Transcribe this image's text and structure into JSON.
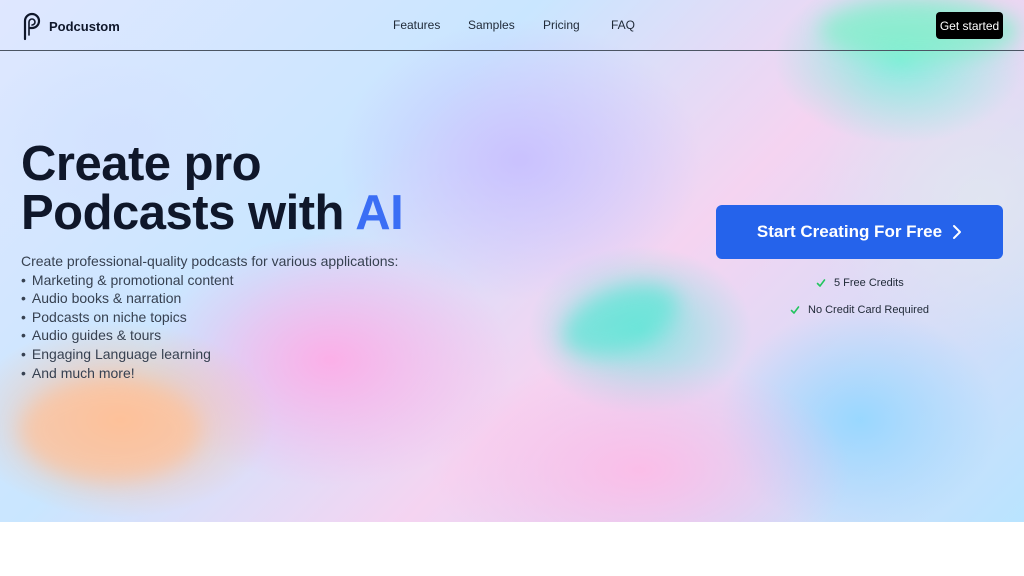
{
  "nav": {
    "brand": "Podcustom",
    "links": [
      "Features",
      "Samples",
      "Pricing",
      "FAQ"
    ],
    "cta": "Get started"
  },
  "hero": {
    "headline_line1": "Create pro",
    "headline_line2_prefix": "Podcasts with ",
    "headline_accent": "AI",
    "intro": "Create professional-quality podcasts for various applications:",
    "bullets": [
      "Marketing & promotional content",
      "Audio books & narration",
      "Podcasts on niche topics",
      "Audio guides & tours",
      "Engaging Language learning",
      "And much more!"
    ],
    "cta": "Start Creating For Free",
    "perks": [
      "5 Free Credits",
      "No Credit Card Required"
    ]
  },
  "colors": {
    "accent": "#2563eb",
    "headline_accent": "#3b6ef5",
    "check": "#22c55e"
  },
  "icons": [
    "podcustom-logo-icon",
    "chevron-right-icon",
    "check-icon"
  ]
}
